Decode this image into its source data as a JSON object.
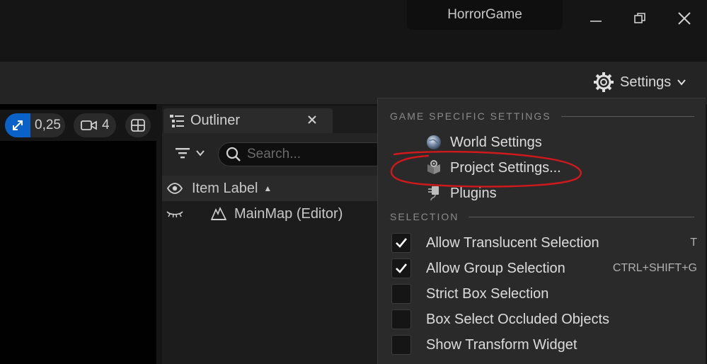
{
  "window": {
    "project_name": "HorrorGame"
  },
  "toolbar": {
    "settings_label": "Settings"
  },
  "viewport_bar": {
    "scale_value": "0,25",
    "camera_speed": "4"
  },
  "outliner": {
    "tab_title": "Outliner",
    "search_placeholder": "Search...",
    "column_header": "Item Label",
    "rows": [
      {
        "label": "MainMap (Editor)"
      }
    ]
  },
  "settings_menu": {
    "section_game": "GAME SPECIFIC SETTINGS",
    "items": [
      {
        "label": "World Settings",
        "icon": "globe-icon"
      },
      {
        "label": "Project Settings...",
        "icon": "project-settings-icon"
      },
      {
        "label": "Plugins",
        "icon": "plugin-icon"
      }
    ],
    "section_selection": "SELECTION",
    "selection_options": [
      {
        "label": "Allow Translucent Selection",
        "checked": true,
        "shortcut": "T"
      },
      {
        "label": "Allow Group Selection",
        "checked": true,
        "shortcut": "CTRL+SHIFT+G"
      },
      {
        "label": "Strict Box Selection",
        "checked": false,
        "shortcut": ""
      },
      {
        "label": "Box Select Occluded Objects",
        "checked": false,
        "shortcut": ""
      },
      {
        "label": "Show Transform Widget",
        "checked": false,
        "shortcut": ""
      }
    ]
  },
  "colors": {
    "accent_blue": "#0a62c9",
    "annotation_red": "#d0191c"
  }
}
